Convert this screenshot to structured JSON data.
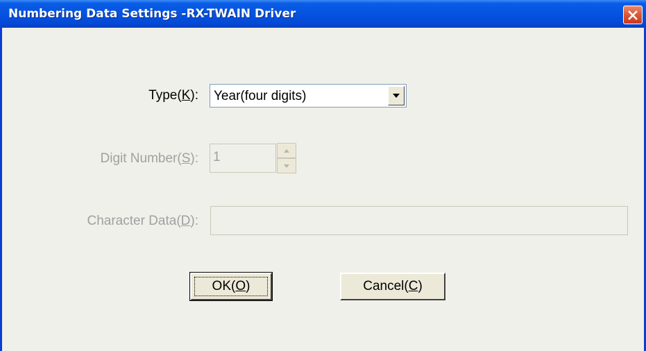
{
  "window": {
    "title": "Numbering Data Settings -RX-TWAIN Driver",
    "close_icon": "close-icon"
  },
  "type_field": {
    "label_pre": "Type(",
    "label_key": "K",
    "label_post": "):",
    "value": "Year(four digits)",
    "dropdown_icon": "chevron-down-icon"
  },
  "digit_field": {
    "label_pre": "Digit Number(",
    "label_key": "S",
    "label_post": "):",
    "value": "1",
    "enabled": false
  },
  "character_field": {
    "label_pre": "Character Data(",
    "label_key": "D",
    "label_post": "):",
    "value": "",
    "enabled": false
  },
  "buttons": {
    "ok_pre": "OK(",
    "ok_key": "O",
    "ok_post": ")",
    "cancel_pre": "Cancel(",
    "cancel_key": "C",
    "cancel_post": ")"
  },
  "colors": {
    "titlebar": "#0553df",
    "dialog_bg": "#f0f0ea",
    "close_button": "#e05a36",
    "disabled_text": "#a0a0a0"
  }
}
